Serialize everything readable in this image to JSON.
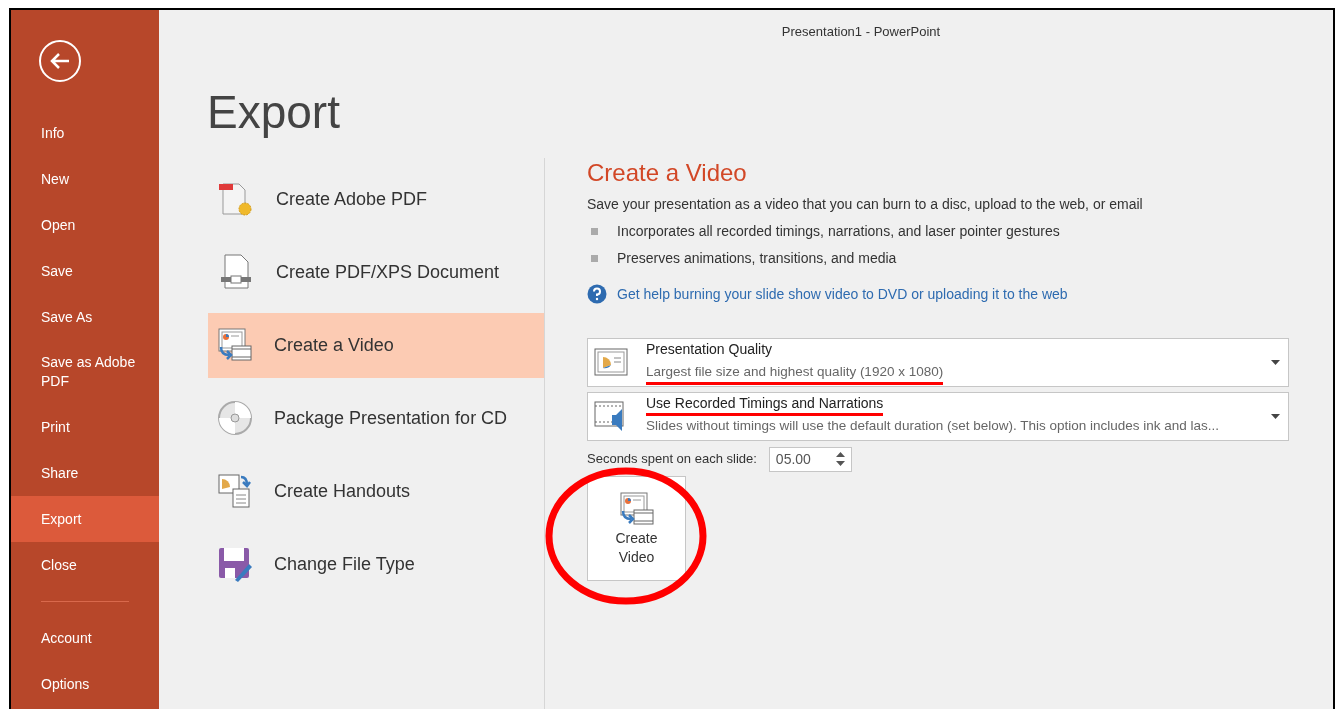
{
  "window": {
    "title": "Presentation1 - PowerPoint"
  },
  "sidebar": {
    "items": [
      {
        "label": "Info",
        "selected": false
      },
      {
        "label": "New",
        "selected": false
      },
      {
        "label": "Open",
        "selected": false
      },
      {
        "label": "Save",
        "selected": false
      },
      {
        "label": "Save As",
        "selected": false
      },
      {
        "label": "Save as Adobe PDF",
        "selected": false
      },
      {
        "label": "Print",
        "selected": false
      },
      {
        "label": "Share",
        "selected": false
      },
      {
        "label": "Export",
        "selected": true
      },
      {
        "label": "Close",
        "selected": false
      }
    ],
    "footer_items": [
      {
        "label": "Account",
        "selected": false
      },
      {
        "label": "Options",
        "selected": false
      }
    ]
  },
  "page_title": "Export",
  "export_options": [
    {
      "label": "Create Adobe PDF",
      "kind": "adobe-pdf",
      "selected": false
    },
    {
      "label": "Create PDF/XPS Document",
      "kind": "xps",
      "selected": false
    },
    {
      "label": "Create a Video",
      "kind": "video",
      "selected": true
    },
    {
      "label": "Package Presentation for CD",
      "kind": "cd",
      "selected": false
    },
    {
      "label": "Create Handouts",
      "kind": "handouts",
      "selected": false
    },
    {
      "label": "Change File Type",
      "kind": "file-type",
      "selected": false
    }
  ],
  "detail": {
    "heading": "Create a Video",
    "description": "Save your presentation as a video that you can burn to a disc, upload to the web, or email",
    "bullets": [
      "Incorporates all recorded timings, narrations, and laser pointer gestures",
      "Preserves animations, transitions, and media"
    ],
    "help_link": "Get help burning your slide show video to DVD or uploading it to the web",
    "dropdowns": [
      {
        "kind": "quality",
        "title": "Presentation Quality",
        "title_marked": false,
        "subtitle": "Largest file size and highest quality (1920 x 1080)",
        "subtitle_marked": true
      },
      {
        "kind": "timings",
        "title": "Use Recorded Timings and Narrations",
        "title_marked": true,
        "subtitle": "Slides without timings will use the default duration (set below). This option includes ink and las...",
        "subtitle_marked": false
      }
    ],
    "seconds_label": "Seconds spent on each slide:",
    "seconds_value": "05.00",
    "create_button": {
      "label": "Create Video",
      "circled": true
    }
  }
}
